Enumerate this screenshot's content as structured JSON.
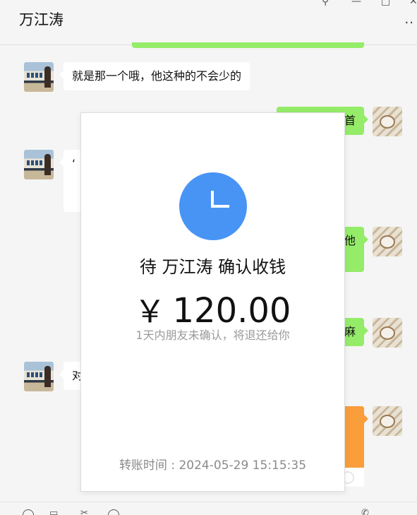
{
  "window": {
    "title": "万江涛",
    "controls": [
      "pin-icon",
      "minimize-icon",
      "maximize-icon",
      "close-icon"
    ],
    "more_label": "··"
  },
  "messages": [
    {
      "side": "left",
      "avatar": "train-avatar",
      "text": "就是那一个哦，他这种的不会少的"
    },
    {
      "side": "right",
      "avatar": "cat-avatar",
      "text": "首"
    },
    {
      "side": "left",
      "avatar": "train-avatar",
      "text": "‘"
    },
    {
      "side": "right",
      "avatar": "cat-avatar",
      "text": "他"
    },
    {
      "side": "right",
      "avatar": "cat-avatar",
      "text": "麻"
    },
    {
      "side": "left",
      "avatar": "train-avatar",
      "text": "对"
    }
  ],
  "transfer_modal": {
    "status_prefix": "待",
    "recipient": "万江涛",
    "status_suffix": "确认收钱",
    "currency": "￥",
    "amount": "120.00",
    "note": "1天内朋友未确认，将退还给你",
    "time_label": "转账时间 :",
    "time_value": "2024-05-29 15:15:35",
    "icon": "clock-icon",
    "icon_color": "#4894f5"
  },
  "colors": {
    "sent_bubble": "#95ec69",
    "received_bubble": "#ffffff",
    "transfer_orange": "#fa9d3b",
    "background": "#f5f5f5"
  }
}
